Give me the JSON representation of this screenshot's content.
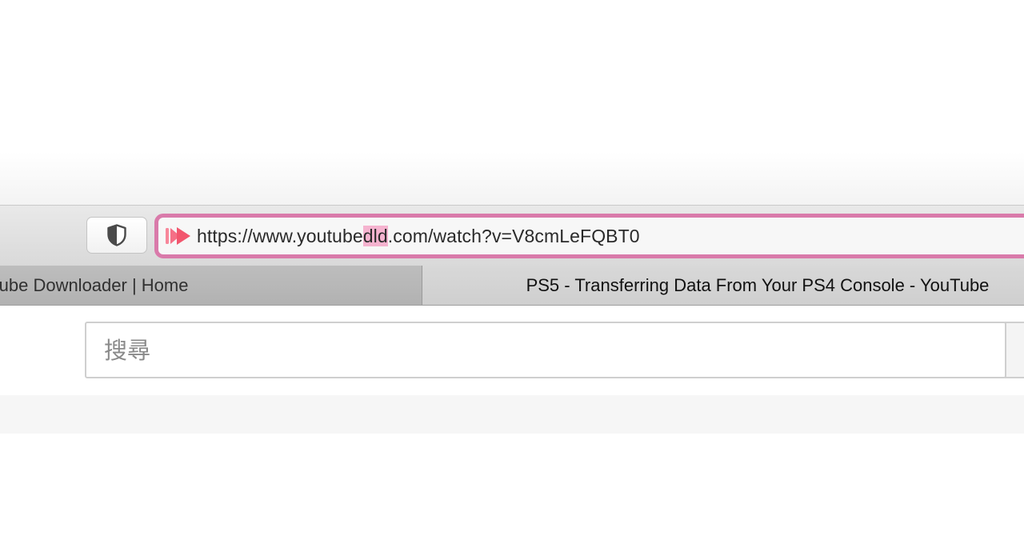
{
  "browser": {
    "address_bar": {
      "url_prefix": "https://www.youtube",
      "url_highlight": "dld",
      "url_suffix": ".com/watch?v=V8cmLeFQBT0"
    },
    "tabs": [
      {
        "title": "Tube Downloader | Home",
        "active": false
      },
      {
        "title": "PS5 - Transferring Data From Your PS4 Console - YouTube",
        "active": true
      }
    ],
    "colors": {
      "address_bar_border": "#d97aaa",
      "url_highlight": "#f5b3cf",
      "site_icon": "#f2566e"
    },
    "icons": {
      "privacy": "shield-icon",
      "site": "youtube-downloader-logo-icon"
    }
  },
  "page": {
    "search": {
      "placeholder": "搜尋",
      "value": ""
    }
  }
}
